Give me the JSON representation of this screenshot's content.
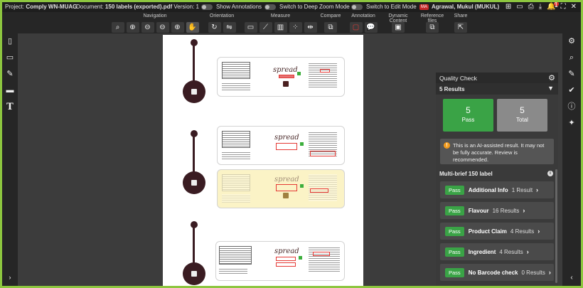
{
  "topbar": {
    "project_label": "Project:",
    "project_name": "Comply WN-MUAG",
    "document_label": "Document:",
    "document_name": "150 labels (exported).pdf",
    "version_label": "Version: 1",
    "version_caret": "⌄",
    "show_annotations": "Show Annotations",
    "deep_zoom": "Switch to Deep Zoom Mode",
    "edit_mode": "Switch to Edit Mode",
    "user_initials": "MA",
    "user_name": "Agrawal, Mukul (MUKUL)",
    "notification_count": "1"
  },
  "toolbar": {
    "navigation": "Navigation",
    "orientation": "Orientation",
    "measure": "Measure",
    "compare": "Compare",
    "annotation": "Annotation",
    "dynamic_content": "Dynamic Content",
    "reference_files": "Reference files",
    "share": "Share"
  },
  "brands": [
    "spread",
    "spread",
    "spread",
    "spread"
  ],
  "quality_check": {
    "title": "Quality Check",
    "results_label": "5 Results",
    "pass_count": "5",
    "pass_label": "Pass",
    "total_count": "5",
    "total_label": "Total",
    "notice": "This is an AI-assisted result. It may not be fully accurate. Review is recommended.",
    "section_title": "Multi-brief 150 label",
    "rows": [
      {
        "status": "Pass",
        "name": "Additional Info",
        "count": "1 Result"
      },
      {
        "status": "Pass",
        "name": "Flavour",
        "count": "16 Results"
      },
      {
        "status": "Pass",
        "name": "Product Claim",
        "count": "4 Results"
      },
      {
        "status": "Pass",
        "name": "Ingredient",
        "count": "4 Results"
      },
      {
        "status": "Pass",
        "name": "No Barcode check",
        "count": "0 Results"
      }
    ]
  },
  "colors": {
    "frame": "#8dc63f",
    "pass": "#3aa346",
    "total": "#8a8a8a",
    "warning": "#f29b1d",
    "annotation_red": "#e53935"
  }
}
